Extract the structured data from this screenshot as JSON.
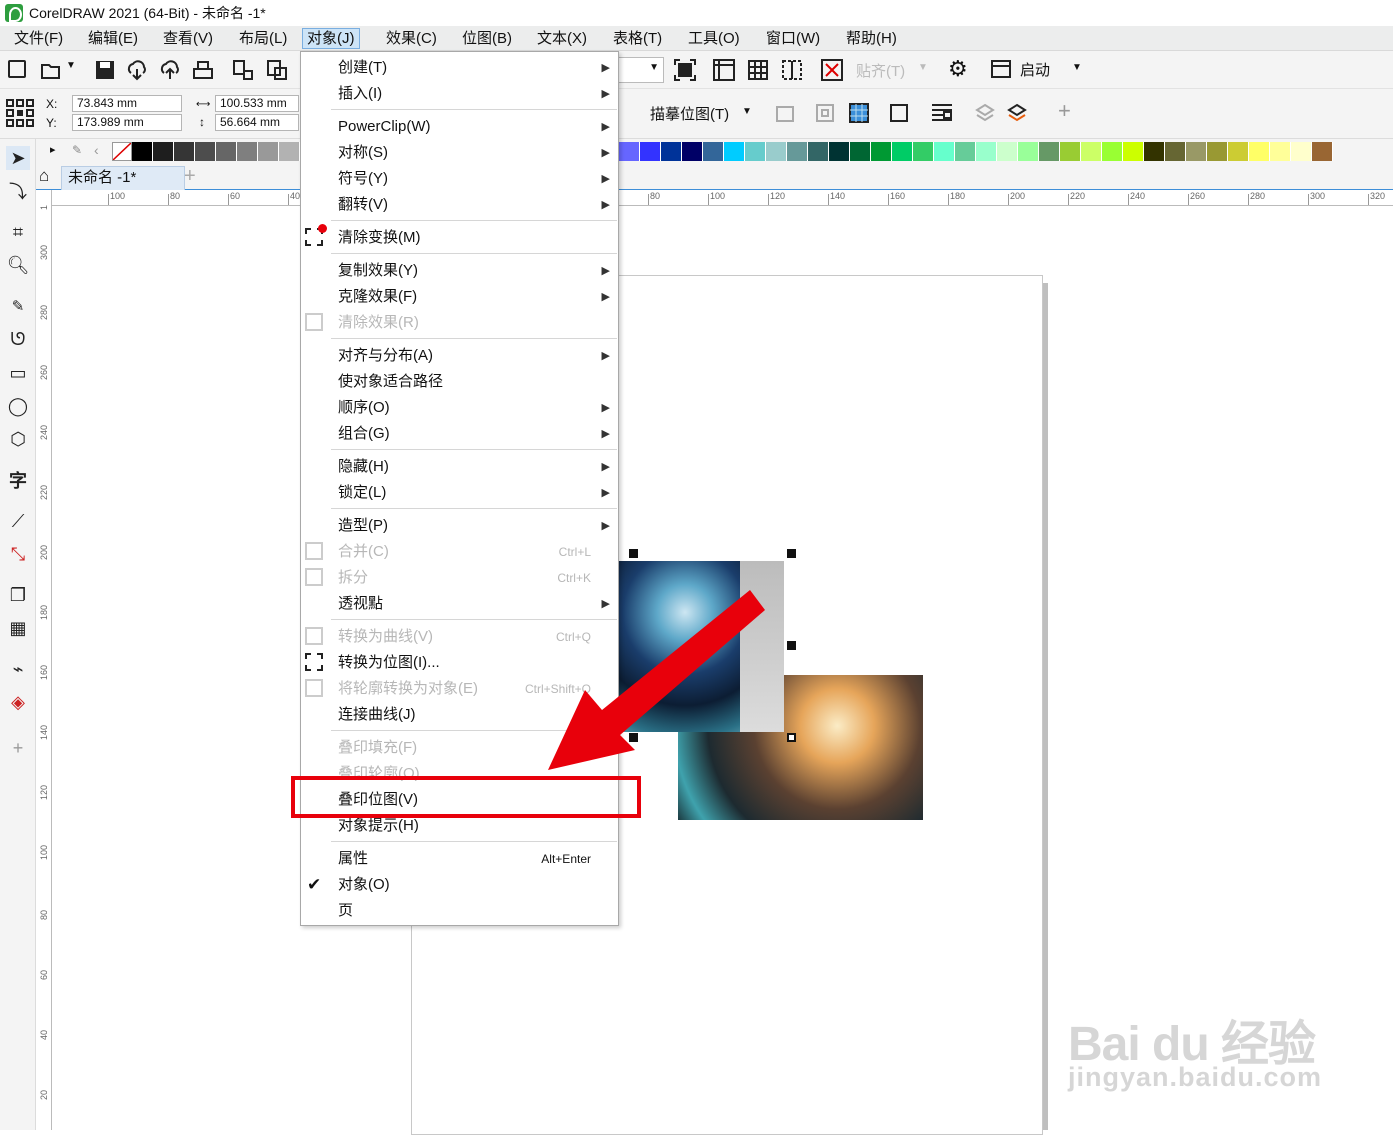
{
  "app": {
    "title": "CorelDRAW 2021 (64-Bit) - 未命名 -1*"
  },
  "menubar": [
    "文件(F)",
    "编辑(E)",
    "查看(V)",
    "布局(L)",
    "对象(J)",
    "效果(C)",
    "位图(B)",
    "文本(X)",
    "表格(T)",
    "工具(O)",
    "窗口(W)",
    "帮助(H)"
  ],
  "toolbar": {
    "snap_label": "贴齐(T)",
    "launch_label": "启动",
    "trace_label": "描摹位图(T)"
  },
  "props": {
    "x_label": "X:",
    "y_label": "Y:",
    "x": "73.843 mm",
    "y": "173.989 mm",
    "w": "100.533 mm",
    "h": "56.664 mm"
  },
  "document_tab": "未命名 -1*",
  "ruler_h": [
    "100",
    "80",
    "60",
    "40",
    "80",
    "100",
    "120",
    "140",
    "160",
    "180",
    "200",
    "220",
    "240",
    "260",
    "280",
    "300",
    "320"
  ],
  "ruler_v": [
    "1",
    "300",
    "280",
    "260",
    "240",
    "220",
    "200",
    "180",
    "160",
    "140",
    "120",
    "100",
    "80",
    "60",
    "40",
    "20"
  ],
  "colors": {
    "accent": "#3d8ed8",
    "highlight": "#e8000b",
    "disabled": "#b7b7b7"
  },
  "palette": [
    "#000000",
    "#1e1e1e",
    "#353535",
    "#4d4d4d",
    "#666666",
    "#7f7f7f",
    "#999999",
    "#b2b2b2",
    "#6666ff",
    "#3333ff",
    "#003399",
    "#000066",
    "#336699",
    "#00ccff",
    "#66cccc",
    "#99cccc",
    "#669999",
    "#336666",
    "#003333",
    "#006633",
    "#009933",
    "#00cc66",
    "#33cc66",
    "#66ffcc",
    "#66cc99",
    "#99ffcc",
    "#ccffcc",
    "#99ff99",
    "#669966",
    "#99cc33",
    "#ccff66",
    "#99ff33",
    "#ccff00",
    "#333300",
    "#666633",
    "#999966",
    "#999933",
    "#cccc33",
    "#ffff66",
    "#ffff99",
    "#ffffcc",
    "#996633"
  ],
  "object_menu": [
    {
      "label": "创建(T)",
      "shortcut": "",
      "submenu": true,
      "disabled": false,
      "sep": false,
      "icon": ""
    },
    {
      "label": "插入(I)",
      "shortcut": "",
      "submenu": true,
      "disabled": false,
      "sep": true,
      "icon": ""
    },
    {
      "label": "PowerClip(W)",
      "shortcut": "",
      "submenu": true,
      "disabled": false,
      "sep": false,
      "icon": ""
    },
    {
      "label": "对称(S)",
      "shortcut": "",
      "submenu": true,
      "disabled": false,
      "sep": false,
      "icon": ""
    },
    {
      "label": "符号(Y)",
      "shortcut": "",
      "submenu": true,
      "disabled": false,
      "sep": false,
      "icon": ""
    },
    {
      "label": "翻转(V)",
      "shortcut": "",
      "submenu": true,
      "disabled": false,
      "sep": true,
      "icon": ""
    },
    {
      "label": "清除变换(M)",
      "shortcut": "",
      "submenu": false,
      "disabled": false,
      "sep": true,
      "icon": "clear-transform-icon"
    },
    {
      "label": "复制效果(Y)",
      "shortcut": "",
      "submenu": true,
      "disabled": false,
      "sep": false,
      "icon": ""
    },
    {
      "label": "克隆效果(F)",
      "shortcut": "",
      "submenu": true,
      "disabled": false,
      "sep": false,
      "icon": ""
    },
    {
      "label": "清除效果(R)",
      "shortcut": "",
      "submenu": false,
      "disabled": true,
      "sep": true,
      "icon": "clear-effect-icon"
    },
    {
      "label": "对齐与分布(A)",
      "shortcut": "",
      "submenu": true,
      "disabled": false,
      "sep": false,
      "icon": ""
    },
    {
      "label": "使对象适合路径",
      "shortcut": "",
      "submenu": false,
      "disabled": false,
      "sep": false,
      "icon": ""
    },
    {
      "label": "顺序(O)",
      "shortcut": "",
      "submenu": true,
      "disabled": false,
      "sep": false,
      "icon": ""
    },
    {
      "label": "组合(G)",
      "shortcut": "",
      "submenu": true,
      "disabled": false,
      "sep": true,
      "icon": ""
    },
    {
      "label": "隐藏(H)",
      "shortcut": "",
      "submenu": true,
      "disabled": false,
      "sep": false,
      "icon": ""
    },
    {
      "label": "锁定(L)",
      "shortcut": "",
      "submenu": true,
      "disabled": false,
      "sep": true,
      "icon": ""
    },
    {
      "label": "造型(P)",
      "shortcut": "",
      "submenu": true,
      "disabled": false,
      "sep": false,
      "icon": ""
    },
    {
      "label": "合并(C)",
      "shortcut": "Ctrl+L",
      "submenu": false,
      "disabled": true,
      "sep": false,
      "icon": "combine-icon"
    },
    {
      "label": "拆分",
      "shortcut": "Ctrl+K",
      "submenu": false,
      "disabled": true,
      "sep": false,
      "icon": "break-apart-icon"
    },
    {
      "label": "透视點",
      "shortcut": "",
      "submenu": true,
      "disabled": false,
      "sep": true,
      "icon": ""
    },
    {
      "label": "转换为曲线(V)",
      "shortcut": "Ctrl+Q",
      "submenu": false,
      "disabled": true,
      "sep": false,
      "icon": "convert-curves-icon"
    },
    {
      "label": "转换为位图(I)...",
      "shortcut": "",
      "submenu": false,
      "disabled": false,
      "sep": false,
      "icon": "convert-bitmap-icon"
    },
    {
      "label": "将轮廓转换为对象(E)",
      "shortcut": "Ctrl+Shift+Q",
      "submenu": false,
      "disabled": true,
      "sep": false,
      "icon": "outline-object-icon"
    },
    {
      "label": "连接曲线(J)",
      "shortcut": "",
      "submenu": false,
      "disabled": false,
      "sep": true,
      "icon": ""
    },
    {
      "label": "叠印填充(F)",
      "shortcut": "",
      "submenu": false,
      "disabled": true,
      "sep": false,
      "icon": ""
    },
    {
      "label": "叠印轮廓(O)",
      "shortcut": "",
      "submenu": false,
      "disabled": true,
      "sep": false,
      "icon": ""
    },
    {
      "label": "叠印位图(V)",
      "shortcut": "",
      "submenu": false,
      "disabled": false,
      "sep": false,
      "icon": ""
    },
    {
      "label": "对象提示(H)",
      "shortcut": "",
      "submenu": false,
      "disabled": false,
      "sep": true,
      "icon": ""
    },
    {
      "label": "属性",
      "shortcut": "Alt+Enter",
      "submenu": false,
      "disabled": false,
      "sep": false,
      "icon": ""
    },
    {
      "label": "对象(O)",
      "shortcut": "",
      "submenu": false,
      "disabled": false,
      "sep": false,
      "icon": "checkmark-icon"
    },
    {
      "label": "页",
      "shortcut": "",
      "submenu": false,
      "disabled": false,
      "sep": false,
      "icon": ""
    }
  ],
  "watermark": {
    "line1": "Bai du 经验",
    "line2": "jingyan.baidu.com"
  }
}
